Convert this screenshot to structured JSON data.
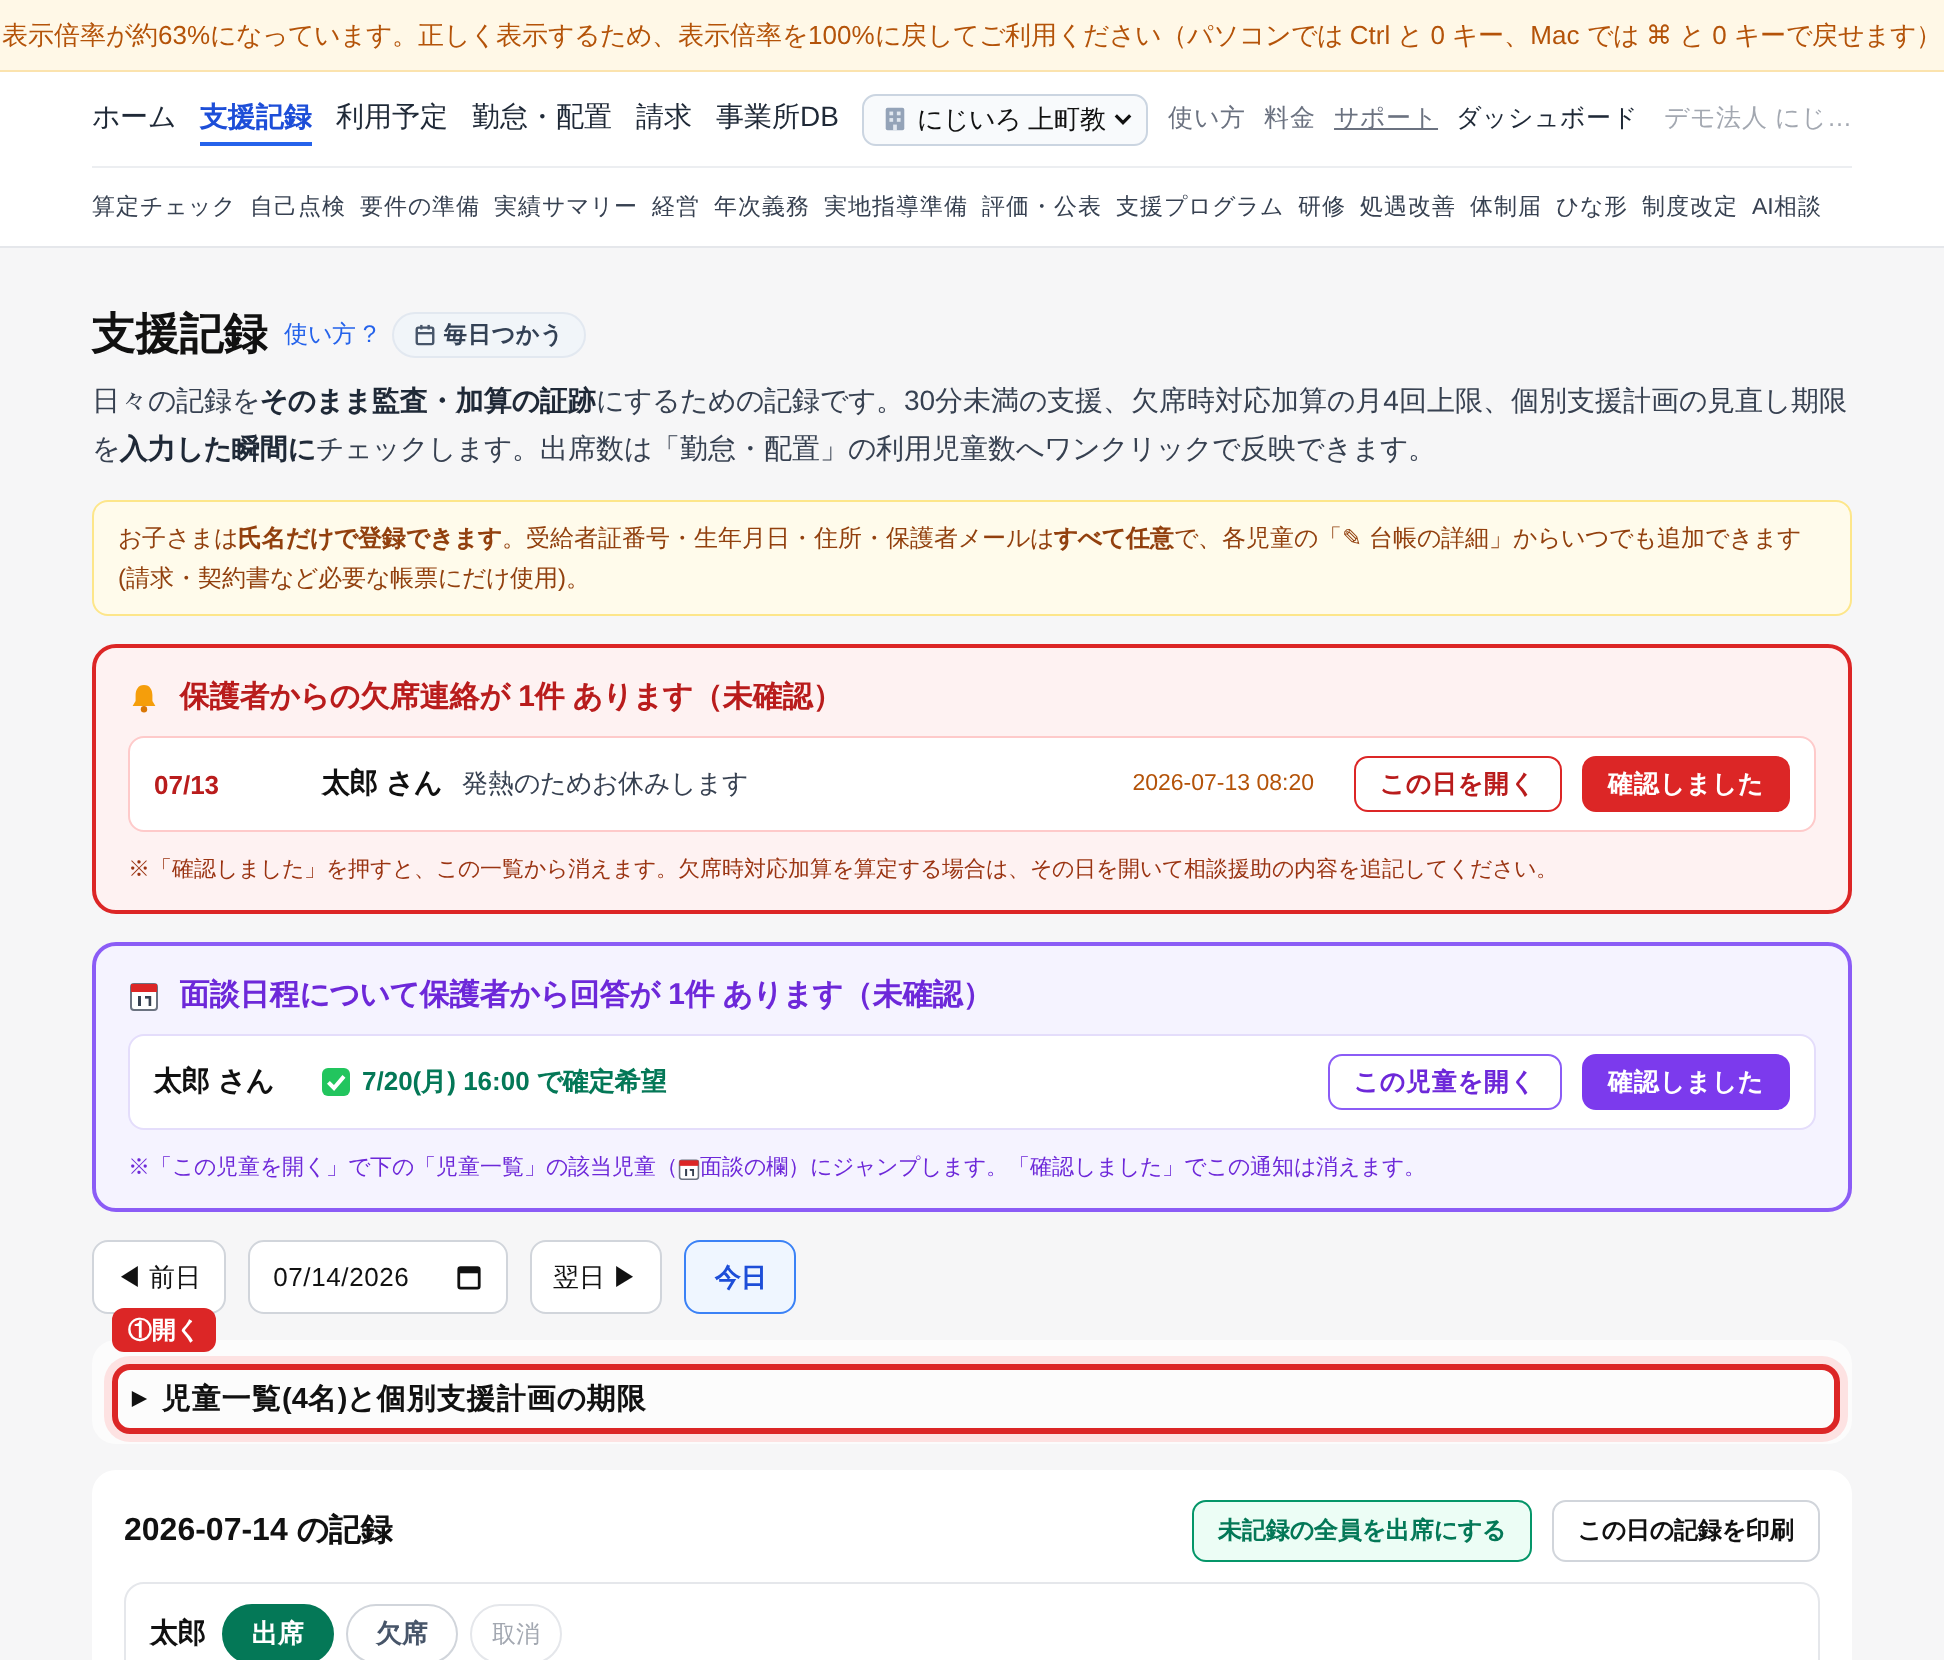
{
  "zoom_banner": {
    "text": "表示倍率が約63%になっています。正しく表示するため、表示倍率を100%に戻してご利用ください（パソコンでは Ctrl と 0 キー、Mac では ⌘ と 0 キーで戻せます）"
  },
  "nav": {
    "items": [
      {
        "label": "ホーム",
        "selected": false
      },
      {
        "label": "支援記録",
        "selected": true
      },
      {
        "label": "利用予定",
        "selected": false
      },
      {
        "label": "勤怠・配置",
        "selected": false
      },
      {
        "label": "請求",
        "selected": false
      },
      {
        "label": "事業所DB",
        "selected": false
      }
    ],
    "facility_select": {
      "value": "にじいろ 上町教"
    },
    "links": [
      {
        "label": "使い方",
        "kind": "plain"
      },
      {
        "label": "料金",
        "kind": "plain"
      },
      {
        "label": "サポート",
        "kind": "underlined"
      },
      {
        "label": "ダッシュボード",
        "kind": "strong"
      },
      {
        "label": "デモ法人 にじ…",
        "kind": "muted"
      }
    ]
  },
  "sub_nav": {
    "items": [
      "算定チェック",
      "自己点検",
      "要件の準備",
      "実績サマリー",
      "経営",
      "年次義務",
      "実地指導準備",
      "評価・公表",
      "支援プログラム",
      "研修",
      "処遇改善",
      "体制届",
      "ひな形",
      "制度改定",
      "AI相談"
    ]
  },
  "page": {
    "title": "支援記録",
    "help_link": "使い方 ?",
    "badge": "毎日つかう",
    "description": "日々の記録を**そのまま監査・加算の証跡**にするための記録です。30分未満の支援、欠席時対応加算の月4回上限、個別支援計画の見直し期限を**入力した瞬間に**チェックします。出席数は「勤怠・配置」の利用児童数へワンクリックで反映できます。"
  },
  "notice": {
    "text": "お子さまは**氏名だけで登録できます**。受給者証番号・生年月日・住所・保護者メールは**すべて任意**で、各児童の「✎ 台帳の詳細」からいつでも追加できます(請求・契約書など必要な帳票にだけ使用)。"
  },
  "alerts": [
    {
      "kind": "absence",
      "title": "保護者からの欠席連絡が 1件 あります（未確認）",
      "items": [
        {
          "date": "07/13",
          "child": "太郎 さん",
          "message": "発熱のためお休みします",
          "timestamp": "2026-07-13 08:20",
          "buttons": [
            {
              "label": "この日を開く",
              "kind": "outline"
            },
            {
              "label": "確認しました",
              "kind": "filled"
            }
          ]
        }
      ],
      "note": [
        "※「確認しました」を押すと、この一覧から消えます。欠席時対応加算を算定する場合は、その日を開いて相談援助の内容を追記してください。"
      ]
    },
    {
      "kind": "interview",
      "title": "面談日程について保護者から回答が 1件 あります（未確認）",
      "items": [
        {
          "child": "太郎 さん",
          "response": "7/20(月) 16:00 で確定希望",
          "buttons": [
            {
              "label": "この児童を開く",
              "kind": "outline"
            },
            {
              "label": "確認しました",
              "kind": "filled"
            }
          ]
        }
      ],
      "note": [
        "※「この児童を開く」で下の「児童一覧」の該当児童（",
        "面談の欄）にジャンプします。「確認しました」でこの通知は消えます。"
      ]
    }
  ],
  "date_nav": {
    "prev": "◀ 前日",
    "date": "07/14/2026",
    "next": "翌日 ▶",
    "today": "今日"
  },
  "children_section": {
    "coach_tag": "①開く",
    "summary": "児童一覧(4名)と個別支援計画の期限",
    "expanded": false,
    "highlighted": true
  },
  "records": {
    "title": "2026-07-14 の記録",
    "buttons": [
      {
        "label": "未記録の全員を出席にする",
        "kind": "success"
      },
      {
        "label": "この日の記録を印刷",
        "kind": "plain"
      }
    ],
    "rows": [
      {
        "name": "太郎",
        "status_buttons": [
          {
            "label": "出席",
            "selected": true
          },
          {
            "label": "欠席",
            "selected": false
          }
        ],
        "clear_button": {
          "label": "取消",
          "disabled": true
        }
      }
    ]
  }
}
